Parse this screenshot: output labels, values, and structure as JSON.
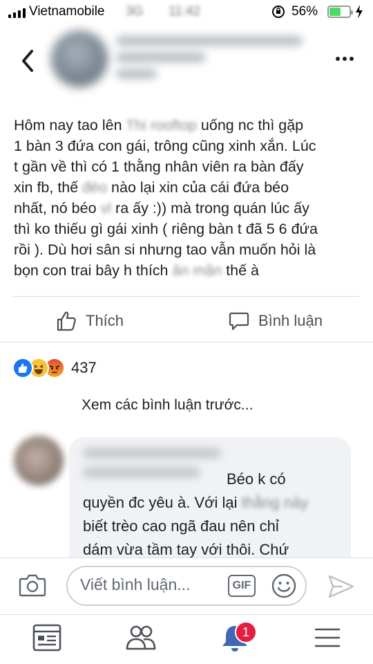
{
  "status_bar": {
    "carrier": "Vietnamobile",
    "network": "3G",
    "time": "11:42",
    "battery_percent": "56%",
    "battery_level": 0.56
  },
  "header": {
    "back_icon": "chevron-left-icon",
    "more_icon": "more-horizontal-icon"
  },
  "post": {
    "lines": [
      [
        "Hôm nay tao lên ",
        "Thi rooftop",
        " uống nc thì gặp"
      ],
      [
        "1 bàn 3 đứa con gái, trông cũng xinh xắn. Lúc"
      ],
      [
        "t gần về thì có 1 thằng nhân viên ra bàn đấy"
      ],
      [
        "xin fb, thế ",
        "đéo",
        " nào lại xin của cái đứa béo"
      ],
      [
        "nhất, nó béo ",
        "vl",
        " ra ấy :)) mà trong quán lúc ấy"
      ],
      [
        "thì ko thiếu gì gái xinh ( riêng bàn t đã 5 6 đứa"
      ],
      [
        "rồi ). Dù hơi sân si nhưng tao vẫn muốn hỏi là"
      ],
      [
        "bọn con trai bây h thích ",
        "ăn mặn",
        " thế à"
      ]
    ]
  },
  "actions": {
    "like_label": "Thích",
    "comment_label": "Bình luận"
  },
  "reactions": {
    "count": "437",
    "types": [
      "like",
      "haha",
      "angry"
    ]
  },
  "comments": {
    "view_previous": "Xem các bình luận trước...",
    "first": {
      "lines": [
        [
          "Béo k có"
        ],
        [
          "quyền đc yêu à. Với lại ",
          "thằng này"
        ],
        [
          "biết trèo cao ngã đau nên chỉ"
        ],
        [
          "dám vừa tầm tay với thôi. Chứ"
        ]
      ]
    }
  },
  "composer": {
    "placeholder": "Viết bình luận...",
    "gif_label": "GIF"
  },
  "tabbar": {
    "notification_badge": "1"
  },
  "colors": {
    "accent": "#1877f2",
    "battery": "#4cd964",
    "badge": "#e41e3f"
  }
}
